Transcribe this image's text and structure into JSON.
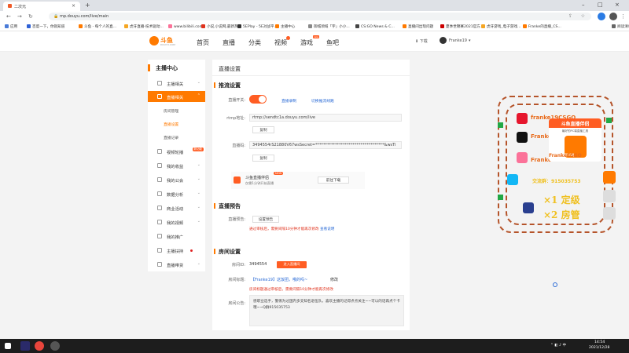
{
  "browser": {
    "tab_title": "二次元",
    "url": "mp.douyu.com/live/main",
    "bookmarks": [
      {
        "label": "应用",
        "color": "#4a7bd8"
      },
      {
        "label": "百度一下，你就知道",
        "color": "#2f62d6"
      },
      {
        "label": "斗鱼 - 每个人的直...",
        "color": "#ff7a00"
      },
      {
        "label": "虎牙直播-技术驱动...",
        "color": "#f5a623"
      },
      {
        "label": "www.bilibili.com",
        "color": "#fb7299"
      },
      {
        "label": "小说,小说网,最新热...",
        "color": "#e0321c"
      },
      {
        "label": "5EPlay - 5E对战平...",
        "color": "#333333"
      },
      {
        "label": "主播中心",
        "color": "#ff7a00"
      },
      {
        "label": "御城领域「宇」小小...",
        "color": "#888888"
      },
      {
        "label": "CS:GO News & C...",
        "color": "#444444"
      },
      {
        "label": "直播间出现问题",
        "color": "#ff7a00"
      },
      {
        "label": "夏季世锦赛2021官方...",
        "color": "#cc0000"
      },
      {
        "label": "虎牙游戏_电子游戏...",
        "color": "#f5a623"
      },
      {
        "label": "Franke的直播_CS...",
        "color": "#ff7a00"
      },
      {
        "label": "阅读清单",
        "color": "#666666"
      }
    ]
  },
  "header": {
    "logo_text": "斗鱼",
    "logo_sub": "DOUYU.COM",
    "nav": [
      "首页",
      "直播",
      "分类",
      "视频",
      "游戏",
      "鱼吧"
    ],
    "game_tag": "new",
    "download": "下载",
    "username": "Franke19"
  },
  "sidebar": {
    "title": "主播中心",
    "items": [
      {
        "label": "主播相关",
        "chev": "⌄"
      },
      {
        "label": "直播相关",
        "chev": "⌃"
      },
      {
        "label": "视频轮播",
        "chev": "",
        "hot": "新功能"
      },
      {
        "label": "我的收益",
        "chev": "⌄"
      },
      {
        "label": "我的公会",
        "chev": "⌄"
      },
      {
        "label": "数据分析",
        "chev": "⌄"
      },
      {
        "label": "商业活动",
        "chev": "⌄"
      },
      {
        "label": "我的视频",
        "chev": "⌄"
      },
      {
        "label": "我的推广",
        "chev": ""
      },
      {
        "label": "主播扶持",
        "chev": ""
      },
      {
        "label": "直播带货",
        "chev": "⌄"
      }
    ],
    "subitems": [
      "房间管理",
      "直播设置",
      "直播记录"
    ]
  },
  "content": {
    "page_title": "直播设置",
    "stream_section": "推流设置",
    "switch_label": "直播开关:",
    "link_record": "直播录制",
    "link_switch": "切换推流线路",
    "rtmp_label": "rtmp地址:",
    "rtmp_value": "rtmp://sendtc1a.douyu.com/live",
    "copy1": "复制",
    "code_label": "直播码:",
    "code_value": "3494554rS21880V67wsSecret=***********************************&wsTi",
    "copy2": "复制",
    "tool_name": "斗鱼直播伴侣",
    "tool_new": "NEW",
    "tool_desc": "仅需1分钟开始直播",
    "tool_btn": "前往下载",
    "preview_section": "直播预告",
    "preview_label": "直播预告:",
    "preview_btn": "设置预告",
    "preview_warn": "通过审核后，需要间隔10分钟才能再次修改",
    "preview_link": "查看说明",
    "room_section": "房间设置",
    "room_id_label": "房间ID:",
    "room_id": "3494554",
    "room_id_btn": "进入直播间",
    "room_title_label": "房间标题:",
    "room_title": "【Franke19】这饭团，哦的吗~",
    "room_title_edit": "修改",
    "room_title_warn": "房间标题通过审核后，需要间隔10分钟才能再次修改",
    "notice_label": "房间公告:",
    "notice_text": "感职业选手，警惕为过国内多支知名退伍队，喜欢主播的记得点点关注~~可以的话再点个卡哦~~Q群915035753"
  },
  "overlay": {
    "promo_title": "斗鱼直播伴侣",
    "promo_sub": "最好的PC端直播工具",
    "promo_btn": "立即下载",
    "handles": [
      "franke19CSGO",
      "Franke19CSGO",
      "FrankeCSGO",
      "FrankeCSGO"
    ],
    "qq": "交流群：915035753",
    "line1": "×1 定级",
    "line2": "×2 房管"
  },
  "taskbar": {
    "time": "14:54",
    "date": "2021/12/28"
  }
}
